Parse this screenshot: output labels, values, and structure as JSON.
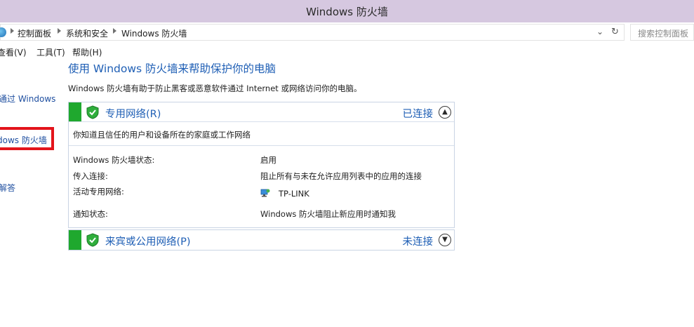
{
  "window": {
    "title": "Windows 防火墙"
  },
  "address": {
    "crumbs": [
      "控制面板",
      "系统和安全",
      "Windows 防火墙"
    ],
    "search_placeholder": "搜索控制面板"
  },
  "menu": [
    "查看(V)",
    "工具(T)",
    "帮助(H)"
  ],
  "leftnav": {
    "items": [
      "通过 Windows",
      "dows 防火墙",
      "解答"
    ]
  },
  "main": {
    "title": "使用 Windows 防火墙来帮助保护你的电脑",
    "description": "Windows 防火墙有助于防止黑客或恶意软件通过 Internet 或网络访问你的电脑。"
  },
  "private_network": {
    "title": "专用网络(R)",
    "status": "已连接",
    "subtitle": "你知道且信任的用户和设备所在的家庭或工作网络",
    "rows": [
      {
        "label": "Windows 防火墙状态:",
        "value": "启用"
      },
      {
        "label": "传入连接:",
        "value": "阻止所有与未在允许应用列表中的应用的连接"
      },
      {
        "label": "活动专用网络:",
        "value": "TP-LINK"
      },
      {
        "label": "通知状态:",
        "value": "Windows 防火墙阻止新应用时通知我"
      }
    ]
  },
  "public_network": {
    "title": "来宾或公用网络(P)",
    "status": "未连接"
  },
  "colors": {
    "title_bar": "#d6c8e0",
    "link_blue": "#1f5fb5",
    "green_bar": "#1fa82e",
    "highlight_red": "#e3141b"
  }
}
